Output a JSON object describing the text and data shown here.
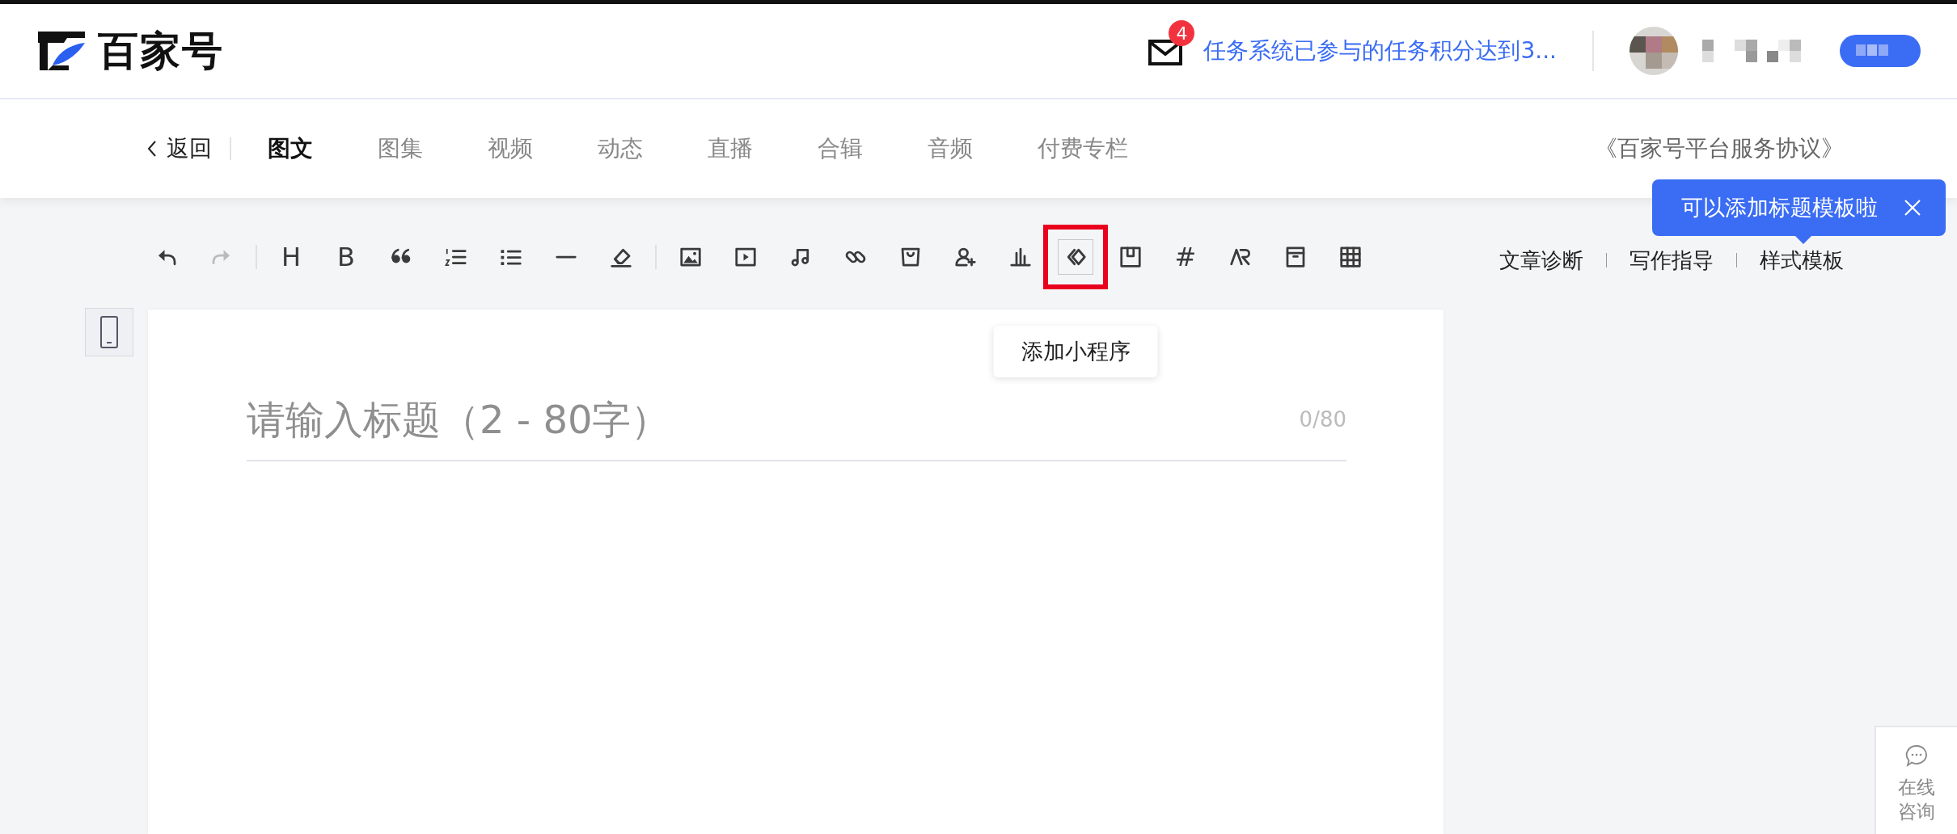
{
  "header": {
    "logo_text": "百家号",
    "notification_count": "4",
    "notification_text": "任务系统已参与的任务积分达到3..."
  },
  "nav": {
    "back_label": "返回",
    "tabs": [
      {
        "label": "图文",
        "selected": true
      },
      {
        "label": "图集",
        "selected": false
      },
      {
        "label": "视频",
        "selected": false
      },
      {
        "label": "动态",
        "selected": false
      },
      {
        "label": "直播",
        "selected": false
      },
      {
        "label": "合辑",
        "selected": false
      },
      {
        "label": "音频",
        "selected": false
      },
      {
        "label": "付费专栏",
        "selected": false
      }
    ],
    "agreement_link": "《百家号平台服务协议》"
  },
  "toolbar": {
    "groups": [
      [
        {
          "kind": "undo",
          "disabled": false,
          "highlighted": false
        },
        {
          "kind": "redo",
          "disabled": true,
          "highlighted": false
        }
      ],
      [
        {
          "kind": "glyph",
          "glyph": "H",
          "disabled": false,
          "highlighted": false
        },
        {
          "kind": "glyph",
          "glyph": "B",
          "disabled": false,
          "highlighted": false
        },
        {
          "kind": "quote",
          "disabled": false,
          "highlighted": false
        },
        {
          "kind": "ordered-list",
          "disabled": false,
          "highlighted": false
        },
        {
          "kind": "bullet-list",
          "disabled": false,
          "highlighted": false
        },
        {
          "kind": "rule",
          "disabled": false,
          "highlighted": false
        },
        {
          "kind": "eraser",
          "disabled": false,
          "highlighted": false
        }
      ],
      [
        {
          "kind": "image",
          "disabled": false,
          "highlighted": false
        },
        {
          "kind": "video",
          "disabled": false,
          "highlighted": false
        },
        {
          "kind": "music",
          "disabled": false,
          "highlighted": false
        },
        {
          "kind": "link",
          "disabled": false,
          "highlighted": false
        },
        {
          "kind": "bag",
          "disabled": false,
          "highlighted": false
        },
        {
          "kind": "person-add",
          "disabled": false,
          "highlighted": false
        },
        {
          "kind": "chart",
          "disabled": false,
          "highlighted": false
        },
        {
          "kind": "mini-program",
          "disabled": false,
          "highlighted": true
        },
        {
          "kind": "bookmark",
          "disabled": false,
          "highlighted": false
        },
        {
          "kind": "glyph",
          "glyph": "#",
          "disabled": false,
          "highlighted": false
        },
        {
          "kind": "ar",
          "disabled": false,
          "highlighted": false
        },
        {
          "kind": "frame",
          "disabled": false,
          "highlighted": false
        },
        {
          "kind": "table",
          "disabled": false,
          "highlighted": false
        }
      ]
    ],
    "links": [
      "文章诊断",
      "写作指导",
      "样式模板"
    ],
    "tool_tooltip": "添加小程序",
    "tip_bubble": "可以添加标题模板啦"
  },
  "editor": {
    "title_placeholder": "请输入标题（2 - 80字）",
    "char_count": "0/80"
  },
  "consult": {
    "label": "在线咨询"
  }
}
